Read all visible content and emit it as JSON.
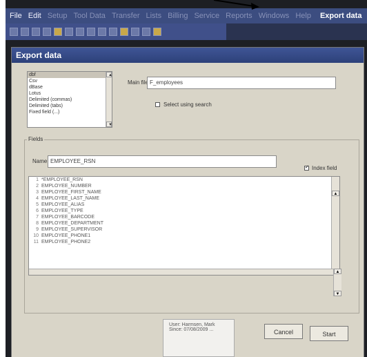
{
  "menu": {
    "items": [
      "File",
      "Edit",
      "Setup",
      "Tool Data",
      "Transfer",
      "Lists",
      "Billing",
      "Service",
      "Reports",
      "Windows",
      "Help"
    ],
    "export_label": "Export data"
  },
  "dialog": {
    "title": "Export data",
    "formats": [
      "dbf",
      "Csv",
      "dBase",
      "Lotus",
      "Delimited (commas)",
      "Delimited (tabs)",
      "Fixed field (...)"
    ],
    "selected_format": "dbf",
    "main_file_label": "Main file",
    "main_file_value": "F_employees",
    "select_using_search_label": "Select using search",
    "fields_group_label": "Fields",
    "name_label": "Name",
    "name_value": "EMPLOYEE_RSN",
    "index_field_label": "Index field",
    "index_field_checked": true,
    "fields": [
      {
        "n": "1",
        "name": "*EMPLOYEE_RSN"
      },
      {
        "n": "2",
        "name": "EMPLOYEE_NUMBER"
      },
      {
        "n": "3",
        "name": "EMPLOYEE_FIRST_NAME"
      },
      {
        "n": "4",
        "name": "EMPLOYEE_LAST_NAME"
      },
      {
        "n": "5",
        "name": "EMPLOYEE_ALIAS"
      },
      {
        "n": "6",
        "name": "EMPLOYEE_TYPE"
      },
      {
        "n": "7",
        "name": "EMPLOYEE_BARCODE"
      },
      {
        "n": "8",
        "name": "EMPLOYEE_DEPARTMENT"
      },
      {
        "n": "9",
        "name": "EMPLOYEE_SUPERVISOR"
      },
      {
        "n": "10",
        "name": "EMPLOYEE_PHONE1"
      },
      {
        "n": "11",
        "name": "EMPLOYEE_PHONE2"
      }
    ],
    "cancel_label": "Cancel",
    "start_label": "Start"
  },
  "background_panel": {
    "line1": "User: Harmsen, Mark",
    "line2": "Since: 07/08/2009 ..."
  },
  "colors": {
    "menubar": "#3c4d80",
    "titlebar": "#3f5596",
    "dialog_bg": "#d9d5c8"
  }
}
